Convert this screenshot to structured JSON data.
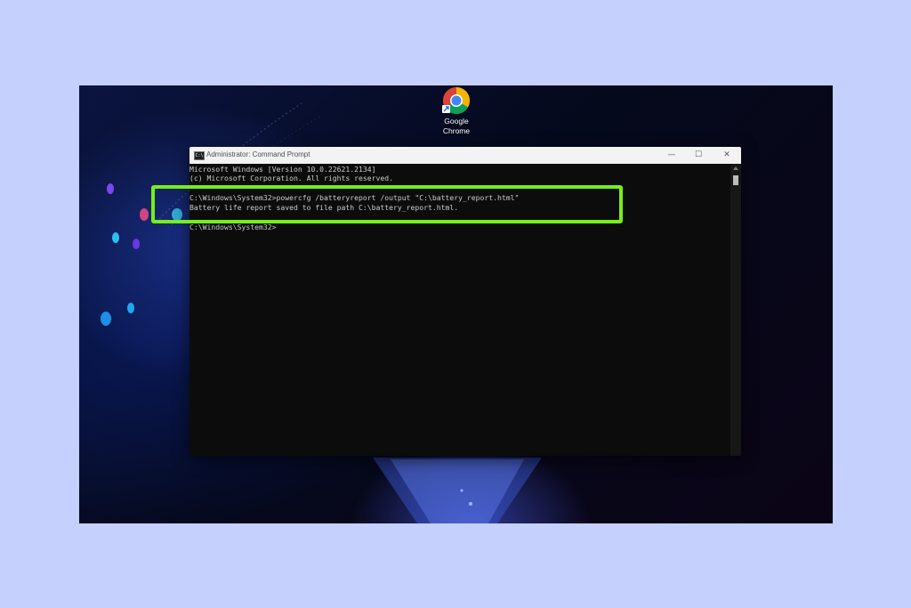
{
  "desktop": {
    "icons": [
      {
        "label": "Google\nChrome",
        "icon": "chrome-icon"
      }
    ]
  },
  "window": {
    "title": "Administrator: Command Prompt",
    "icon": "cmd-icon",
    "buttons": {
      "minimize": "—",
      "maximize": "☐",
      "close": "✕"
    }
  },
  "console": {
    "lines": [
      "Microsoft Windows [Version 10.0.22621.2134]",
      "(c) Microsoft Corporation. All rights reserved.",
      "C:\\Windows\\System32>powercfg /batteryreport /output \"C:\\battery_report.html\"",
      "Battery life report saved to file path C:\\battery_report.html.",
      "C:\\Windows\\System32>"
    ]
  },
  "colors": {
    "page_background": "#c5d0fd",
    "console_background": "#0c0c0c",
    "console_text": "#cccccc",
    "highlight": "#73f01a"
  }
}
